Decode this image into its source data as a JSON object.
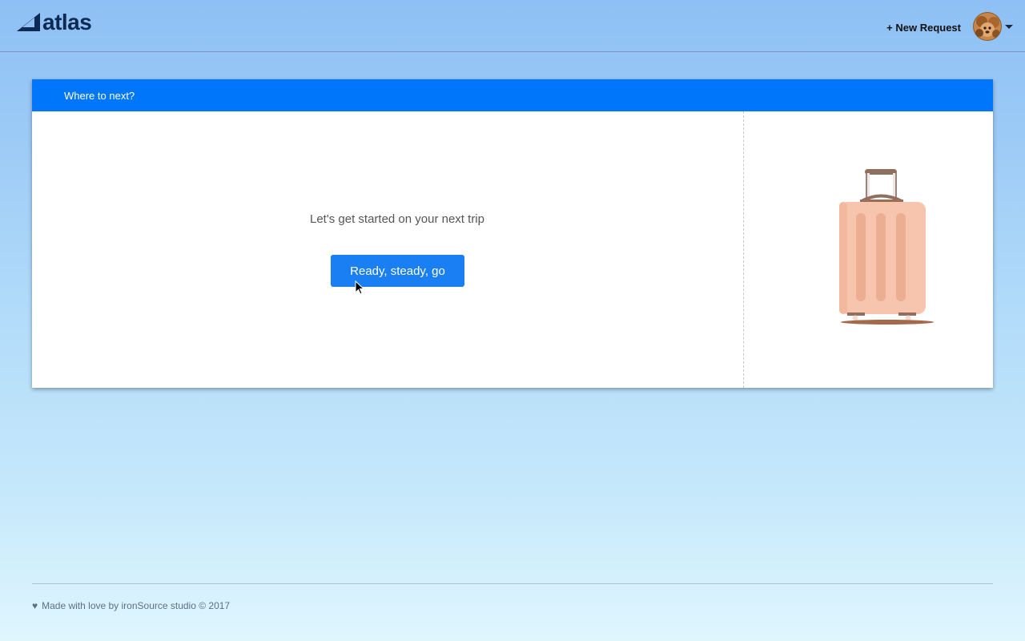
{
  "header": {
    "brand": "atlas",
    "new_request_label": "+ New Request"
  },
  "card": {
    "title": "Where to next?",
    "prompt": "Let's get started on your next trip",
    "button_label": "Ready, steady, go"
  },
  "footer": {
    "heart_glyph": "♥",
    "text": "Made with love by ironSource studio © 2017"
  },
  "colors": {
    "brand_dark": "#0f2a52",
    "header_bar": "#0077fa",
    "primary_button": "#1a7ff2"
  },
  "icons": [
    "atlas-logo-icon",
    "avatar",
    "chevron-down-icon",
    "suitcase-illustration",
    "mouse-cursor-icon",
    "heart-icon"
  ]
}
